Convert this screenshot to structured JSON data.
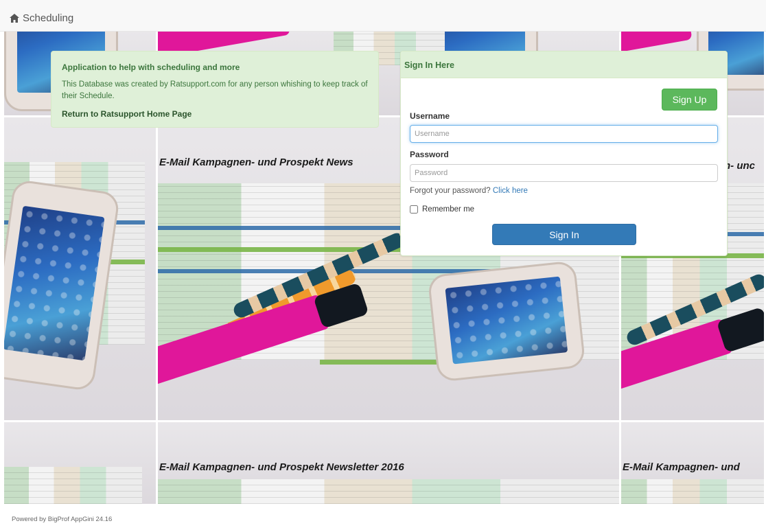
{
  "navbar": {
    "brand_icon": "home-icon",
    "brand_label": "Scheduling"
  },
  "background": {
    "headline": "E-Mail Kampagnen- und Prospekt Newsletter 2016",
    "headline_short": "E-Mail Kampagnen- und Prospekt News",
    "headline_right": "E-Mail Kampagnen- und",
    "headline_right_top": "n- unc"
  },
  "info": {
    "title": "Application to help with scheduling and more",
    "description": "This Database was created by Ratsupport.com for any person whishing to keep track of their Schedule.",
    "home_link": "Return to Ratsupport Home Page"
  },
  "login": {
    "heading": "Sign In Here",
    "signup_label": "Sign Up",
    "username_label": "Username",
    "username_placeholder": "Username",
    "password_label": "Password",
    "password_placeholder": "Password",
    "forgot_text": "Forgot your password?",
    "forgot_link": "Click here",
    "remember_label": "Remember me",
    "signin_label": "Sign In"
  },
  "footer": {
    "text": "Powered by BigProf AppGini 24.16"
  },
  "colors": {
    "panel_green": "#dff0d8",
    "panel_text": "#3c763d",
    "signup_green": "#5cb85c",
    "signin_blue": "#337ab7",
    "link_blue": "#337ab7"
  }
}
